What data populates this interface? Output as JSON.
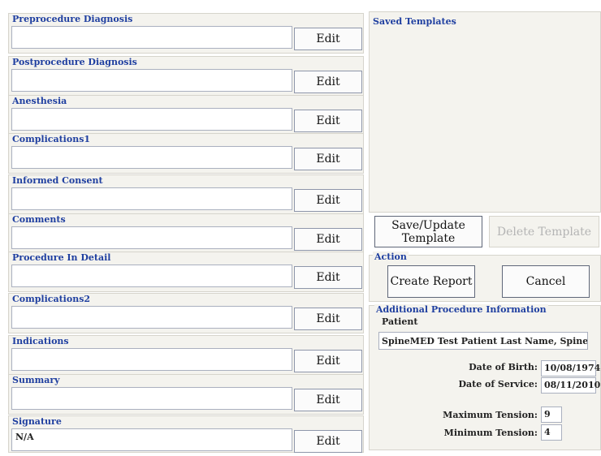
{
  "sections": [
    {
      "label": "Preprocedure Diagnosis",
      "value": "",
      "edit": "Edit"
    },
    {
      "label": "Postprocedure Diagnosis",
      "value": "",
      "edit": "Edit"
    },
    {
      "label": "Anesthesia",
      "value": "",
      "edit": "Edit"
    },
    {
      "label": "Complications1",
      "value": "",
      "edit": "Edit"
    },
    {
      "label": "Informed Consent",
      "value": "",
      "edit": "Edit"
    },
    {
      "label": "Comments",
      "value": "",
      "edit": "Edit"
    },
    {
      "label": "Procedure In Detail",
      "value": "",
      "edit": "Edit"
    },
    {
      "label": "Complications2",
      "value": "",
      "edit": "Edit"
    },
    {
      "label": "Indications",
      "value": "",
      "edit": "Edit"
    },
    {
      "label": "Summary",
      "value": "",
      "edit": "Edit"
    },
    {
      "label": "Signature",
      "value": "N/A",
      "edit": "Edit"
    }
  ],
  "templates": {
    "title": "Saved Templates",
    "save_update_label": "Save/Update Template",
    "delete_label": "Delete Template"
  },
  "action": {
    "title": "Action",
    "create_report_label": "Create Report",
    "cancel_label": "Cancel"
  },
  "additional": {
    "title": "Additional Procedure Information",
    "patient_label": "Patient",
    "patient_value": "SpineMED Test Patient Last Name, SpineMED",
    "dob_label": "Date of Birth:",
    "dob_value": "10/08/1974",
    "dos_label": "Date of Service:",
    "dos_value": "08/11/2010",
    "max_tension_label": "Maximum Tension:",
    "max_tension_value": "9",
    "min_tension_label": "Minimum Tension:",
    "min_tension_value": "4"
  }
}
